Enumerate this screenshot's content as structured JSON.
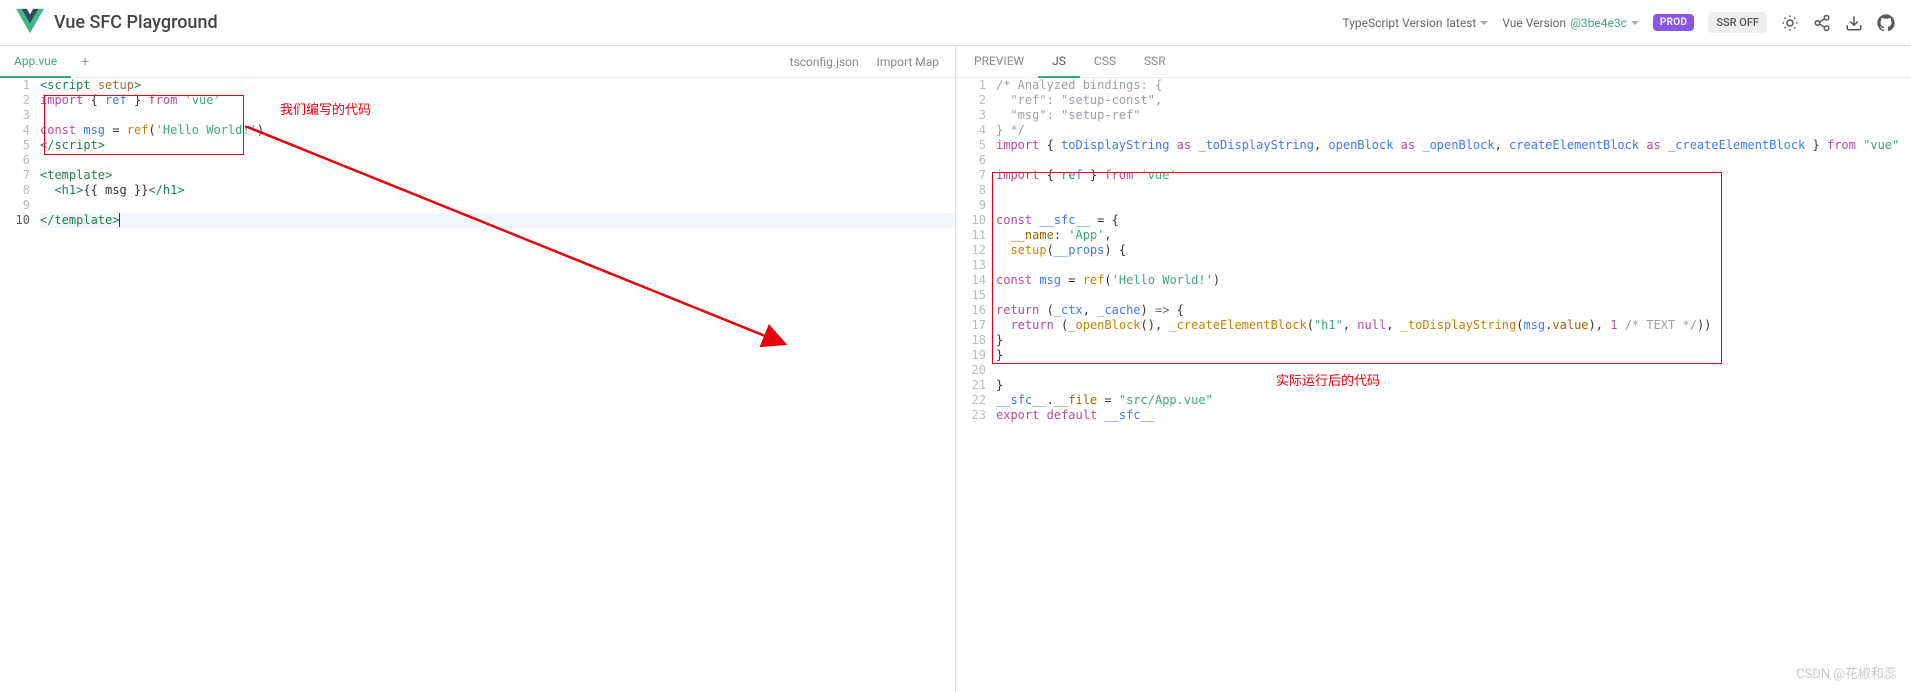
{
  "header": {
    "title": "Vue SFC Playground",
    "ts_version_label": "TypeScript Version",
    "ts_version_value": "latest",
    "vue_version_label": "Vue Version",
    "vue_version_value": "@3be4e3c",
    "prod_badge": "PROD",
    "ssr_badge": "SSR OFF"
  },
  "left_tabs": {
    "active": "App.vue",
    "right": [
      "tsconfig.json",
      "Import Map"
    ]
  },
  "right_tabs": [
    "PREVIEW",
    "JS",
    "CSS",
    "SSR"
  ],
  "right_active": "JS",
  "annotations": {
    "left": "我们编写的代码",
    "right": "实际运行后的代码"
  },
  "watermark": "CSDN @花椒和蕊",
  "source_code": [
    {
      "n": 1,
      "html": "<span class='tk-tag'>&lt;script</span> <span class='tk-attr'>setup</span><span class='tk-tag'>&gt;</span>"
    },
    {
      "n": 2,
      "html": "<span class='tk-kw'>import</span> { <span class='tk-id'>ref</span> } <span class='tk-kw'>from</span> <span class='tk-str'>'vue'</span>"
    },
    {
      "n": 3,
      "html": ""
    },
    {
      "n": 4,
      "html": "<span class='tk-kw'>const</span> <span class='tk-id'>msg</span> = <span class='tk-fn'>ref</span>(<span class='tk-str'>'Hello World!'</span>)"
    },
    {
      "n": 5,
      "html": "<span class='tk-tag'>&lt;/script&gt;</span>"
    },
    {
      "n": 6,
      "html": ""
    },
    {
      "n": 7,
      "html": "<span class='tk-tag'>&lt;template&gt;</span>"
    },
    {
      "n": 8,
      "html": "  <span class='tk-tag'>&lt;h1&gt;</span>{{ msg }}<span class='tk-tag'>&lt;/h1&gt;</span>"
    },
    {
      "n": 9,
      "html": ""
    },
    {
      "n": 10,
      "html": "<span class='tk-tag'>&lt;/template&gt;</span><span class='cursor'></span>",
      "cur": true
    }
  ],
  "compiled_code": [
    {
      "n": 1,
      "html": "<span class='tk-cmt'>/* Analyzed bindings: {</span>"
    },
    {
      "n": 2,
      "html": "<span class='tk-cmt'>  \"ref\": \"setup-const\",</span>"
    },
    {
      "n": 3,
      "html": "<span class='tk-cmt'>  \"msg\": \"setup-ref\"</span>"
    },
    {
      "n": 4,
      "html": "<span class='tk-cmt'>} */</span>"
    },
    {
      "n": 5,
      "html": "<span class='tk-kw'>import</span> { <span class='tk-id'>toDisplayString</span> <span class='tk-kw'>as</span> <span class='tk-id'>_toDisplayString</span>, <span class='tk-id'>openBlock</span> <span class='tk-kw'>as</span> <span class='tk-id'>_openBlock</span>, <span class='tk-id'>createElementBlock</span> <span class='tk-kw'>as</span> <span class='tk-id'>_createElementBlock</span> } <span class='tk-kw'>from</span> <span class='tk-str'>\"vue\"</span>"
    },
    {
      "n": 6,
      "html": ""
    },
    {
      "n": 7,
      "html": "<span class='tk-kw'>import</span> { <span class='tk-id'>ref</span> } <span class='tk-kw'>from</span> <span class='tk-str'>'vue'</span>"
    },
    {
      "n": 8,
      "html": ""
    },
    {
      "n": 9,
      "html": ""
    },
    {
      "n": 10,
      "html": "<span class='tk-kw'>const</span> <span class='tk-id'>__sfc__</span> = {"
    },
    {
      "n": 11,
      "html": "  <span class='tk-prop'>__name</span>: <span class='tk-str'>'App'</span>,"
    },
    {
      "n": 12,
      "html": "  <span class='tk-fn'>setup</span>(<span class='tk-id'>__props</span>) {"
    },
    {
      "n": 13,
      "html": ""
    },
    {
      "n": 14,
      "html": "<span class='tk-kw'>const</span> <span class='tk-id'>msg</span> = <span class='tk-fn'>ref</span>(<span class='tk-str'>'Hello World!'</span>)"
    },
    {
      "n": 15,
      "html": ""
    },
    {
      "n": 16,
      "html": "<span class='tk-kw'>return</span> (<span class='tk-id'>_ctx</span>, <span class='tk-id'>_cache</span>) <span class='tk-punc'>=&gt;</span> {"
    },
    {
      "n": 17,
      "html": "  <span class='tk-kw'>return</span> (<span class='tk-fn'>_openBlock</span>(), <span class='tk-fn'>_createElementBlock</span>(<span class='tk-str'>\"h1\"</span>, <span class='tk-kw'>null</span>, <span class='tk-fn'>_toDisplayString</span>(<span class='tk-id'>msg</span>.<span class='tk-prop'>value</span>), <span class='tk-num'>1</span> <span class='tk-cmt'>/* TEXT */</span>))"
    },
    {
      "n": 18,
      "html": "}"
    },
    {
      "n": 19,
      "html": "}"
    },
    {
      "n": 20,
      "html": ""
    },
    {
      "n": 21,
      "html": "}"
    },
    {
      "n": 22,
      "html": "<span class='tk-id'>__sfc__</span>.<span class='tk-prop'>__file</span> = <span class='tk-str'>\"src/App.vue\"</span>"
    },
    {
      "n": 23,
      "html": "<span class='tk-kw'>export</span> <span class='tk-kw'>default</span> <span class='tk-id'>__sfc__</span>"
    }
  ]
}
